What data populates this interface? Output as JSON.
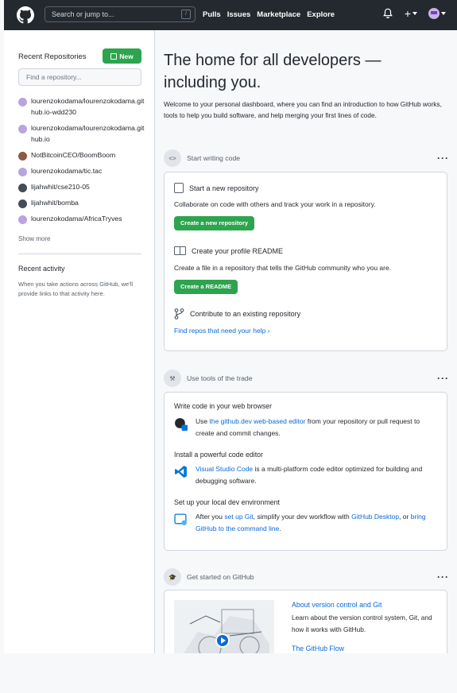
{
  "header": {
    "search_placeholder": "Search or jump to...",
    "search_key": "/",
    "nav": [
      "Pulls",
      "Issues",
      "Marketplace",
      "Explore"
    ],
    "plus_label": "+"
  },
  "sidebar": {
    "title": "Recent Repositories",
    "new_label": "New",
    "find_placeholder": "Find a repository...",
    "repos": [
      {
        "name": "lourenzokodama/lourenzokodama.github.io-wdd230",
        "avatar_color": "#b9a4e0"
      },
      {
        "name": "lourenzokodama/lourenzokodama.github.io",
        "avatar_color": "#b9a4e0"
      },
      {
        "name": "NotBitcoinCEO/BoomBoom",
        "avatar_color": "#8a5a44"
      },
      {
        "name": "lourenzokodama/tic.tac",
        "avatar_color": "#b9a4e0"
      },
      {
        "name": "lijahwhit/cse210-05",
        "avatar_color": "#444c56"
      },
      {
        "name": "lijahwhit/bomba",
        "avatar_color": "#444c56"
      },
      {
        "name": "lourenzokodama/AfricaTryves",
        "avatar_color": "#b9a4e0"
      }
    ],
    "show_more": "Show more",
    "recent_activity_title": "Recent activity",
    "recent_activity_text": "When you take actions across GitHub, we'll provide links to that activity here."
  },
  "main": {
    "hero": "The home for all developers — including you.",
    "intro": "Welcome to your personal dashboard, where you can find an introduction to how GitHub works, tools to help you build software, and help merging your first lines of code.",
    "start": {
      "title": "Start writing code",
      "new_repo_title": "Start a new repository",
      "new_repo_desc": "Collaborate on code with others and track your work in a repository.",
      "new_repo_button": "Create a new repository",
      "readme_title": "Create your profile README",
      "readme_desc": "Create a file in a repository that tells the GitHub community who you are.",
      "readme_button": "Create a README",
      "contribute_title": "Contribute to an existing repository",
      "contribute_link": "Find repos that need your help"
    },
    "tools": {
      "title": "Use tools of the trade",
      "web_title": "Write code in your web browser",
      "web_pre": "Use ",
      "web_link": "the github.dev web-based editor",
      "web_post": " from your repository or pull request to create and commit changes.",
      "editor_title": "Install a powerful code editor",
      "editor_link": "Visual Studio Code",
      "editor_post": " is a multi-platform code editor optimized for building and debugging software.",
      "local_title": "Set up your local dev environment",
      "local_pre": "After you ",
      "local_link1": "set up Git",
      "local_mid1": ", simplify your dev workflow with ",
      "local_link2": "GitHub Desktop",
      "local_mid2": ", or ",
      "local_link3": "bring GitHub to the command line",
      "local_post": "."
    },
    "started": {
      "title": "Get started on GitHub",
      "link1": "About version control and Git",
      "desc1": "Learn about the version control system, Git, and how it works with GitHub.",
      "link2": "The GitHub Flow"
    }
  },
  "colors": {
    "header_bg": "#24292f",
    "green": "#2da44e",
    "link": "#0969da"
  }
}
